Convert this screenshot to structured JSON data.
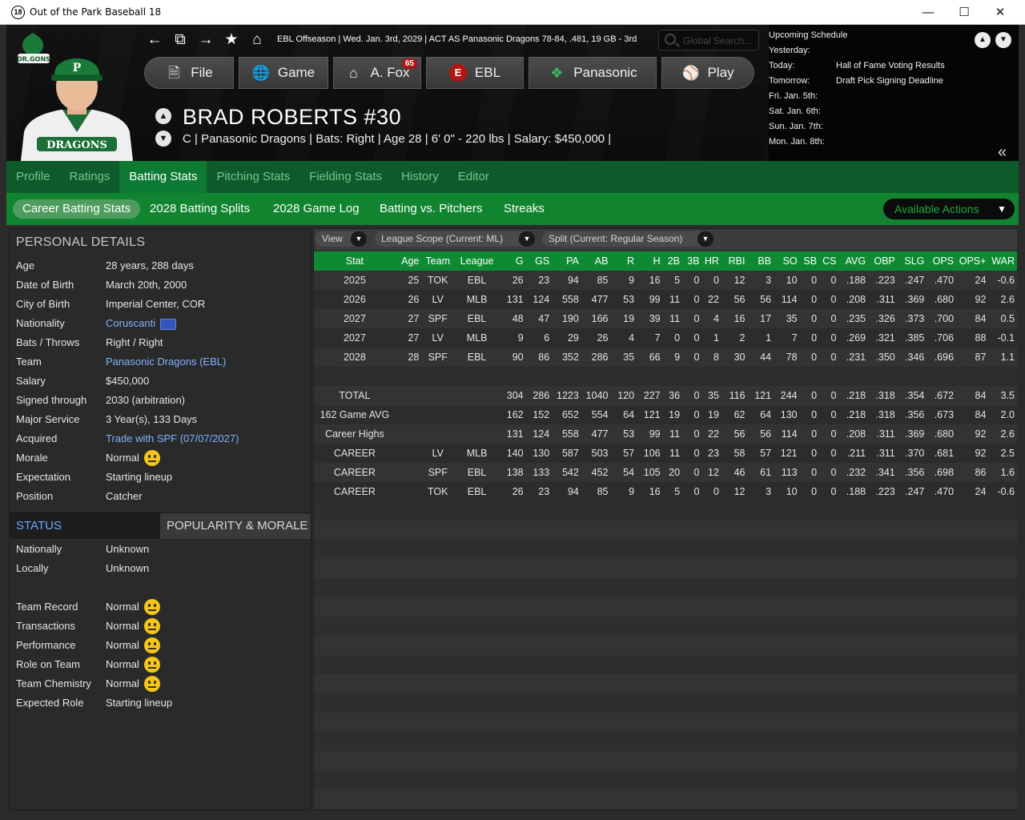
{
  "window": {
    "title": "Out of the Park Baseball 18",
    "app_icon": "18"
  },
  "header": {
    "status_line": "EBL Offseason  |  Wed. Jan. 3rd, 2029  |  ACT AS Panasonic Dragons   78-84, .481, 19 GB - 3rd",
    "search_placeholder": "Global Search...",
    "menu": [
      {
        "label": "File",
        "icon": "file-icon"
      },
      {
        "label": "Game",
        "icon": "globe-icon"
      },
      {
        "label": "A. Fox",
        "icon": "home-icon",
        "badge": "65"
      },
      {
        "label": "EBL",
        "icon": "league-logo-icon"
      },
      {
        "label": "Panasonic",
        "icon": "team-logo-icon"
      },
      {
        "label": "Play",
        "icon": "baseball-icon"
      }
    ],
    "player_name": "BRAD ROBERTS  #30",
    "player_info": "C | Panasonic Dragons  |  Bats: Right  |  Age 28  |  6' 0\" - 220 lbs  |  Salary: $450,000  |",
    "logo_text": "DR.GONS"
  },
  "schedule": {
    "title": "Upcoming Schedule",
    "rows": [
      {
        "label": "Yesterday:",
        "value": ""
      },
      {
        "label": "Today:",
        "value": "Hall of Fame Voting Results"
      },
      {
        "label": "Tomorrow:",
        "value": "Draft Pick Signing Deadline"
      },
      {
        "label": "Fri. Jan. 5th:",
        "value": ""
      },
      {
        "label": "Sat. Jan. 6th:",
        "value": ""
      },
      {
        "label": "Sun. Jan. 7th:",
        "value": ""
      },
      {
        "label": "Mon. Jan. 8th:",
        "value": ""
      }
    ]
  },
  "tabs": [
    "Profile",
    "Ratings",
    "Batting Stats",
    "Pitching Stats",
    "Fielding Stats",
    "History",
    "Editor"
  ],
  "subtabs": [
    "Career Batting Stats",
    "2028 Batting Splits",
    "2028 Game Log",
    "Batting vs. Pitchers",
    "Streaks"
  ],
  "actions_label": "Available Actions",
  "personal": {
    "title": "PERSONAL DETAILS",
    "rows": [
      {
        "k": "Age",
        "v": "28 years, 288 days"
      },
      {
        "k": "Date of Birth",
        "v": "March 20th, 2000"
      },
      {
        "k": "City of Birth",
        "v": "Imperial Center, COR"
      },
      {
        "k": "Nationality",
        "v": "Coruscanti",
        "link": true,
        "flag": true
      },
      {
        "k": "Bats / Throws",
        "v": "Right / Right"
      },
      {
        "k": "Team",
        "v": "Panasonic Dragons (EBL)",
        "link": true
      },
      {
        "k": "Salary",
        "v": "$450,000"
      },
      {
        "k": "Signed through",
        "v": "2030 (arbitration)"
      },
      {
        "k": "Major Service",
        "v": "3 Year(s), 133 Days"
      },
      {
        "k": "Acquired",
        "v": "Trade with SPF (07/07/2027)",
        "link": true
      },
      {
        "k": "Morale",
        "v": "Normal",
        "smiley": true
      },
      {
        "k": "Expectation",
        "v": "Starting lineup"
      },
      {
        "k": "Position",
        "v": "Catcher"
      }
    ]
  },
  "status": {
    "tab_active": "STATUS",
    "tab_inactive": "POPULARITY & MORALE",
    "rows": [
      {
        "k": "Nationally",
        "v": "Unknown"
      },
      {
        "k": "Locally",
        "v": "Unknown"
      },
      {
        "k": "",
        "v": ""
      },
      {
        "k": "Team Record",
        "v": "Normal",
        "smiley": true
      },
      {
        "k": "Transactions",
        "v": "Normal",
        "smiley": true
      },
      {
        "k": "Performance",
        "v": "Normal",
        "smiley": true
      },
      {
        "k": "Role on Team",
        "v": "Normal",
        "smiley": true
      },
      {
        "k": "Team Chemistry",
        "v": "Normal",
        "smiley": true
      },
      {
        "k": "Expected Role",
        "v": "Starting lineup"
      }
    ]
  },
  "filters": [
    "View",
    "League Scope  (Current: ML)",
    "Split  (Current: Regular Season)"
  ],
  "table": {
    "columns": [
      "Stat",
      "Age",
      "Team",
      "League",
      "G",
      "GS",
      "PA",
      "AB",
      "R",
      "H",
      "2B",
      "3B",
      "HR",
      "RBI",
      "BB",
      "SO",
      "SB",
      "CS",
      "AVG",
      "OBP",
      "SLG",
      "OPS",
      "OPS+",
      "WAR"
    ],
    "rows": [
      [
        "2025",
        "25",
        "TOK",
        "EBL",
        "26",
        "23",
        "94",
        "85",
        "9",
        "16",
        "5",
        "0",
        "0",
        "12",
        "3",
        "10",
        "0",
        "0",
        ".188",
        ".223",
        ".247",
        ".470",
        "24",
        "-0.6"
      ],
      [
        "2026",
        "26",
        "LV",
        "MLB",
        "131",
        "124",
        "558",
        "477",
        "53",
        "99",
        "11",
        "0",
        "22",
        "56",
        "56",
        "114",
        "0",
        "0",
        ".208",
        ".311",
        ".369",
        ".680",
        "92",
        "2.6"
      ],
      [
        "2027",
        "27",
        "SPF",
        "EBL",
        "48",
        "47",
        "190",
        "166",
        "19",
        "39",
        "11",
        "0",
        "4",
        "16",
        "17",
        "35",
        "0",
        "0",
        ".235",
        ".326",
        ".373",
        ".700",
        "84",
        "0.5"
      ],
      [
        "2027",
        "27",
        "LV",
        "MLB",
        "9",
        "6",
        "29",
        "26",
        "4",
        "7",
        "0",
        "0",
        "1",
        "2",
        "1",
        "7",
        "0",
        "0",
        ".269",
        ".321",
        ".385",
        ".706",
        "88",
        "-0.1"
      ],
      [
        "2028",
        "28",
        "SPF",
        "EBL",
        "90",
        "86",
        "352",
        "286",
        "35",
        "66",
        "9",
        "0",
        "8",
        "30",
        "44",
        "78",
        "0",
        "0",
        ".231",
        ".350",
        ".346",
        ".696",
        "87",
        "1.1"
      ],
      [
        "",
        "",
        "",
        "",
        "",
        "",
        "",
        "",
        "",
        "",
        "",
        "",
        "",
        "",
        "",
        "",
        "",
        "",
        "",
        "",
        "",
        "",
        "",
        ""
      ],
      [
        "TOTAL",
        "",
        "",
        "",
        "304",
        "286",
        "1223",
        "1040",
        "120",
        "227",
        "36",
        "0",
        "35",
        "116",
        "121",
        "244",
        "0",
        "0",
        ".218",
        ".318",
        ".354",
        ".672",
        "84",
        "3.5"
      ],
      [
        "162 Game AVG",
        "",
        "",
        "",
        "162",
        "152",
        "652",
        "554",
        "64",
        "121",
        "19",
        "0",
        "19",
        "62",
        "64",
        "130",
        "0",
        "0",
        ".218",
        ".318",
        ".356",
        ".673",
        "84",
        "2.0"
      ],
      [
        "Career Highs",
        "",
        "",
        "",
        "131",
        "124",
        "558",
        "477",
        "53",
        "99",
        "11",
        "0",
        "22",
        "56",
        "56",
        "114",
        "0",
        "0",
        ".208",
        ".311",
        ".369",
        ".680",
        "92",
        "2.6"
      ],
      [
        "CAREER",
        "",
        "LV",
        "MLB",
        "140",
        "130",
        "587",
        "503",
        "57",
        "106",
        "11",
        "0",
        "23",
        "58",
        "57",
        "121",
        "0",
        "0",
        ".211",
        ".311",
        ".370",
        ".681",
        "92",
        "2.5"
      ],
      [
        "CAREER",
        "",
        "SPF",
        "EBL",
        "138",
        "133",
        "542",
        "452",
        "54",
        "105",
        "20",
        "0",
        "12",
        "46",
        "61",
        "113",
        "0",
        "0",
        ".232",
        ".341",
        ".356",
        ".698",
        "86",
        "1.6"
      ],
      [
        "CAREER",
        "",
        "TOK",
        "EBL",
        "26",
        "23",
        "94",
        "85",
        "9",
        "16",
        "5",
        "0",
        "0",
        "12",
        "3",
        "10",
        "0",
        "0",
        ".188",
        ".223",
        ".247",
        ".470",
        "24",
        "-0.6"
      ]
    ]
  },
  "colors": {
    "tab_green": "#0d5a2a",
    "subtab_green": "#10842f",
    "header_green": "#0e8a33",
    "link_blue": "#7fb3ff"
  }
}
